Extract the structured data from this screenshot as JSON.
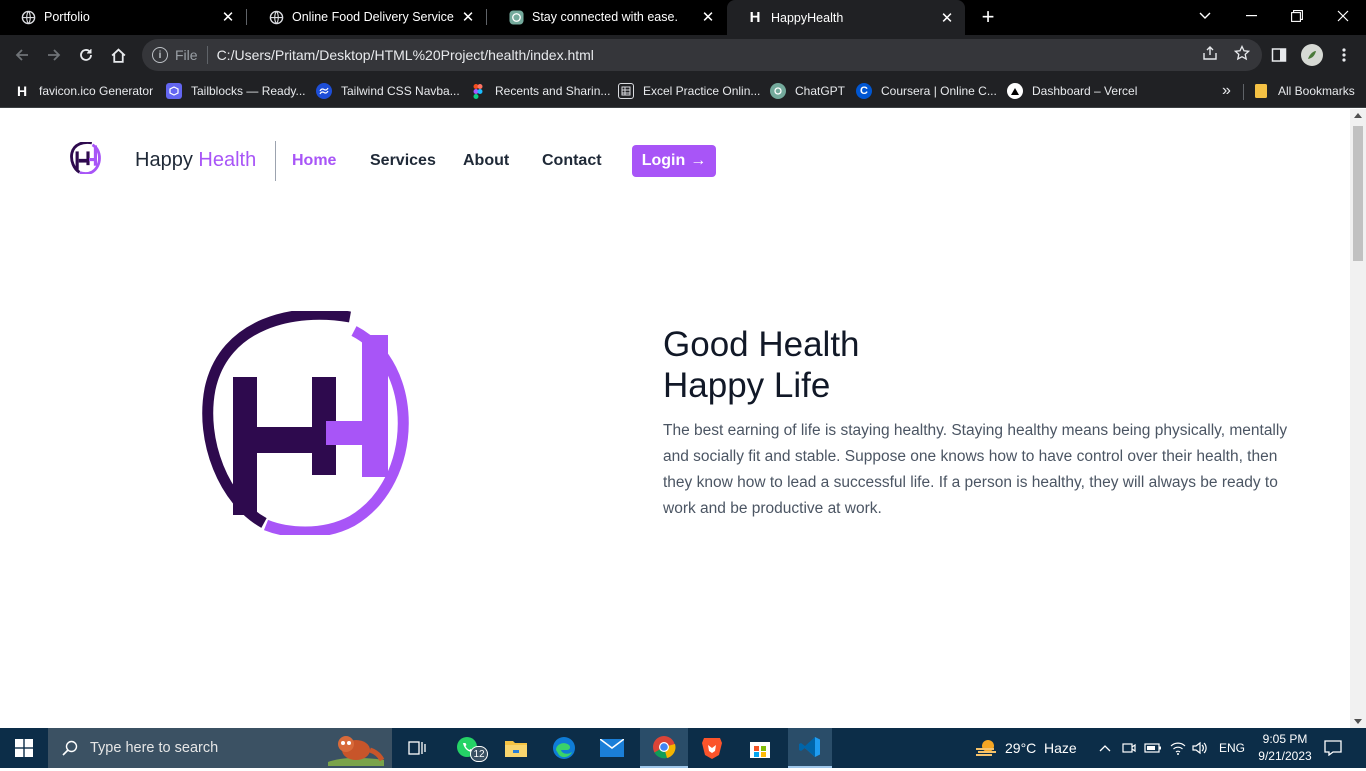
{
  "browser": {
    "tabs": [
      {
        "title": "Portfolio",
        "active": false
      },
      {
        "title": "Online Food Delivery Service | W",
        "active": false
      },
      {
        "title": "Stay connected with ease.",
        "active": false
      },
      {
        "title": "HappyHealth",
        "active": true
      }
    ],
    "address": {
      "scheme_label": "File",
      "url": "C:/Users/Pritam/Desktop/HTML%20Project/health/index.html"
    },
    "bookmarks": [
      {
        "label": "favicon.ico Generator",
        "icon": "H"
      },
      {
        "label": "Tailblocks — Ready...",
        "icon": "tailblocks-icon"
      },
      {
        "label": "Tailwind CSS Navba...",
        "icon": "tailwind-icon"
      },
      {
        "label": "Recents and Sharin...",
        "icon": "figma-icon"
      },
      {
        "label": "Excel Practice Onlin...",
        "icon": "excel-icon"
      },
      {
        "label": "ChatGPT",
        "icon": "chatgpt-icon"
      },
      {
        "label": "Coursera | Online C...",
        "icon": "C"
      },
      {
        "label": "Dashboard – Vercel",
        "icon": "vercel-icon"
      }
    ],
    "overflow_label": "»",
    "all_bookmarks_label": "All Bookmarks"
  },
  "site": {
    "brand_part1": "Happy",
    "brand_part2": "Health",
    "nav": [
      {
        "label": "Home",
        "active": true
      },
      {
        "label": "Services",
        "active": false
      },
      {
        "label": "About",
        "active": false
      },
      {
        "label": "Contact",
        "active": false
      }
    ],
    "login_label": "Login",
    "login_arrow": "→",
    "hero": {
      "title_line1": "Good Health",
      "title_line2": "Happy Life",
      "paragraph": "The best earning of life is staying healthy. Staying healthy means being physically, mentally and socially fit and stable. Suppose one knows how to have control over their health, then they know how to lead a successful life. If a person is healthy, they will always be ready to work and be productive at work."
    },
    "colors": {
      "accent": "#a855f7",
      "dark": "#2e0a4e"
    }
  },
  "taskbar": {
    "search_placeholder": "Type here to search",
    "whatsapp_badge": "12",
    "weather_temp": "29°C",
    "weather_label": "Haze",
    "language": "ENG",
    "time": "9:05 PM",
    "date": "9/21/2023"
  }
}
